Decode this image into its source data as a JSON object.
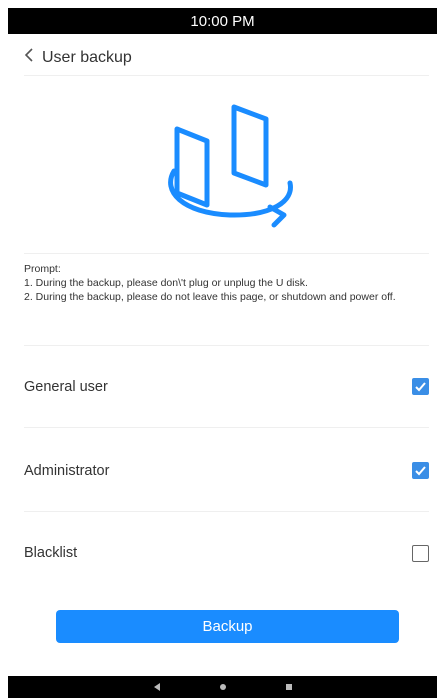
{
  "status_bar": {
    "time": "10:00 PM"
  },
  "header": {
    "back_icon": "chevron-left-icon",
    "title": "User backup"
  },
  "hero": {
    "icon": "backup-devices-icon",
    "accent": "#1a8cff"
  },
  "prompt": {
    "heading": "Prompt:",
    "line1": "1. During the backup, please don\\'t plug or unplug the U disk.",
    "line2": "2. During the backup, please do not leave this page, or  shutdown and power off."
  },
  "options": [
    {
      "label": "General user",
      "checked": true
    },
    {
      "label": "Administrator",
      "checked": true
    },
    {
      "label": "Blacklist",
      "checked": false
    }
  ],
  "backup_button": {
    "label": "Backup",
    "color": "#1a8cff"
  },
  "nav_bar": {
    "icons": [
      "back-icon",
      "home-icon",
      "recents-icon"
    ]
  }
}
